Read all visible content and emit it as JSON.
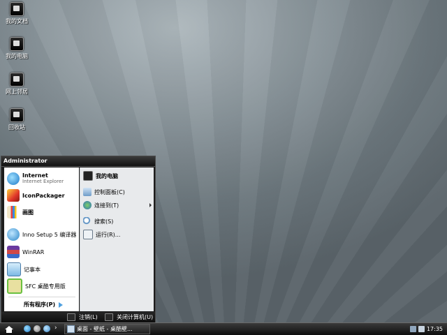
{
  "desktop": {
    "icons": [
      {
        "label": "我的文档",
        "icon": "my-documents-icon"
      },
      {
        "label": "我的电脑",
        "icon": "my-computer-icon"
      },
      {
        "label": "网上邻居",
        "icon": "network-places-icon"
      },
      {
        "label": "回收站",
        "icon": "recycle-bin-icon"
      }
    ]
  },
  "start_menu": {
    "user": "Administrator",
    "programs": [
      {
        "title": "Internet",
        "subtitle": "Internet Explorer",
        "icon": "internet-explorer-icon"
      },
      {
        "title": "IconPackager",
        "icon": "iconpackager-icon"
      },
      {
        "title": "画图",
        "icon": "paint-icon"
      },
      {
        "title": "Inno Setup 5 编译器",
        "icon": "inno-setup-icon"
      },
      {
        "title": "WinRAR",
        "icon": "winrar-icon"
      },
      {
        "title": "记事本",
        "icon": "notepad-icon"
      },
      {
        "title": "SFC 桌酷专用版",
        "icon": "sfc-icon"
      }
    ],
    "all_programs": "所有程序(P)",
    "places": [
      {
        "label": "我的电脑",
        "icon": "my-computer-icon"
      },
      {
        "label": "控制面板(C)",
        "icon": "control-panel-icon"
      },
      {
        "label": "连接到(T)",
        "icon": "connect-to-icon"
      },
      {
        "label": "搜索(S)",
        "icon": "search-icon"
      },
      {
        "label": "运行(R)...",
        "icon": "run-icon"
      }
    ],
    "logoff": "注销(L)",
    "shutdown": "关闭计算机(U)"
  },
  "taskbar": {
    "task": "桌面 - 壁纸 - 桌酷壁...",
    "clock": "17:35"
  },
  "colors": {
    "accent": "#4fa0e0",
    "taskbar": "#1a1a1a"
  }
}
